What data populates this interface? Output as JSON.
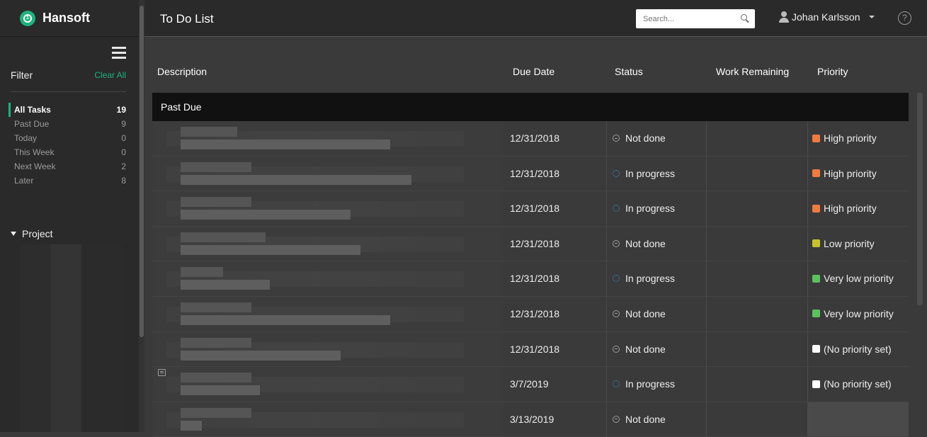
{
  "app": {
    "brand": "Hansoft"
  },
  "topbar": {
    "title": "To Do List",
    "search_placeholder": "Search...",
    "user_name": "Johan Karlsson",
    "help_label": "?"
  },
  "sidebar": {
    "filter_title": "Filter",
    "clear_all": "Clear All",
    "filters": [
      {
        "label": "All Tasks",
        "count": "19",
        "active": true
      },
      {
        "label": "Past Due",
        "count": "9"
      },
      {
        "label": "Today",
        "count": "0"
      },
      {
        "label": "This Week",
        "count": "0"
      },
      {
        "label": "Next Week",
        "count": "2"
      },
      {
        "label": "Later",
        "count": "8"
      }
    ],
    "project_title": "Project"
  },
  "table": {
    "headers": {
      "description": "Description",
      "due_date": "Due Date",
      "status": "Status",
      "work_remaining": "Work Remaining",
      "priority": "Priority"
    },
    "group": "Past Due",
    "rows": [
      {
        "due": "12/31/2018",
        "status": "Not done",
        "priority": "High priority"
      },
      {
        "due": "12/31/2018",
        "status": "In progress",
        "priority": "High priority"
      },
      {
        "due": "12/31/2018",
        "status": "In progress",
        "priority": "High priority"
      },
      {
        "due": "12/31/2018",
        "status": "Not done",
        "priority": "Low priority"
      },
      {
        "due": "12/31/2018",
        "status": "In progress",
        "priority": "Very low priority"
      },
      {
        "due": "12/31/2018",
        "status": "Not done",
        "priority": "Very low priority"
      },
      {
        "due": "12/31/2018",
        "status": "Not done",
        "priority": "(No priority set)"
      },
      {
        "due": "3/7/2019",
        "status": "In progress",
        "priority": "(No priority set)"
      },
      {
        "due": "3/13/2019",
        "status": "Not done",
        "priority": ""
      }
    ]
  },
  "colors": {
    "accent": "#1db27e",
    "high": "#f07a40",
    "low": "#c8c22a",
    "very_low": "#5cc05c",
    "none": "#ffffff"
  }
}
